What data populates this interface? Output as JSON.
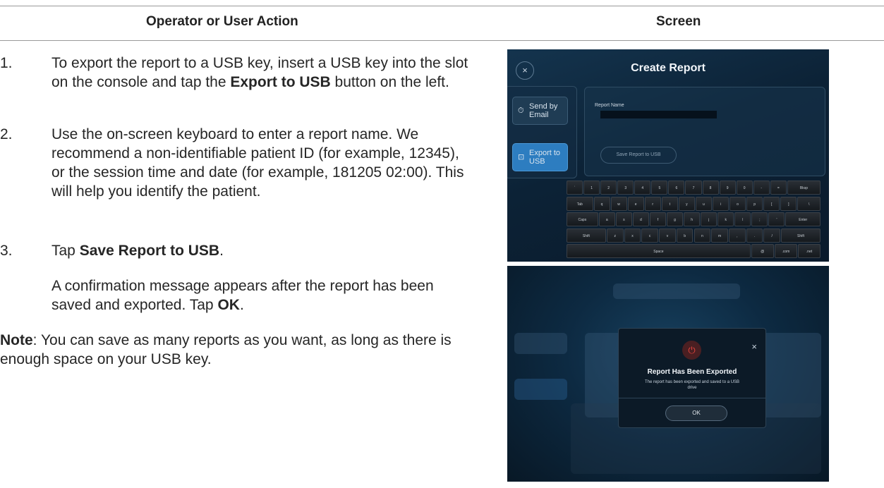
{
  "header": {
    "col_action": "Operator or User Action",
    "col_screen": "Screen"
  },
  "steps": [
    {
      "num": "1.",
      "parts": [
        "To export the report to a USB key, insert a USB key into the slot on the console and tap the ",
        "Export to USB",
        " button on the left."
      ]
    },
    {
      "num": "2.",
      "parts": [
        "Use the on-screen keyboard to enter a report name. We recommend a non-identifiable patient ID (for example, 12345), or the session time and date (for example, 181205 02:00). This will help you identify the patient."
      ]
    },
    {
      "num": "3.",
      "parts": [
        "Tap ",
        "Save Report to USB",
        "."
      ]
    }
  ],
  "confirm": {
    "parts": [
      "A confirmation message appears after the report has been saved and exported. Tap ",
      "OK",
      "."
    ]
  },
  "note": {
    "label": "Note",
    "text": ": You can save as many reports as you want, as long as there is enough space on your USB key."
  },
  "screen1": {
    "close_icon": "×",
    "title": "Create Report",
    "send_email_label": "Send by Email",
    "send_email_icon": "⏱",
    "export_usb_label": "Export to USB",
    "export_usb_icon": "⊡",
    "report_name_label": "Report Name",
    "save_button": "Save Report to USB",
    "keyboard": [
      [
        "`",
        "1",
        "2",
        "3",
        "4",
        "5",
        "6",
        "7",
        "8",
        "9",
        "0",
        "-",
        "=",
        "Bksp"
      ],
      [
        "Tab",
        "q",
        "w",
        "e",
        "r",
        "t",
        "y",
        "u",
        "i",
        "o",
        "p",
        "[",
        "]",
        "\\"
      ],
      [
        "Caps",
        "a",
        "s",
        "d",
        "f",
        "g",
        "h",
        "j",
        "k",
        "l",
        ";",
        "'",
        "Enter"
      ],
      [
        "Shift",
        "z",
        "x",
        "c",
        "v",
        "b",
        "n",
        "m",
        ",",
        ".",
        "/",
        "Shift"
      ],
      [
        "Space",
        "@",
        ".com",
        ".net"
      ]
    ]
  },
  "screen2": {
    "dialog_title": "Report Has Been Exported",
    "dialog_message": "The report has been exported and saved to a USB drive",
    "ok_button": "OK",
    "close_icon": "×",
    "power_icon": "⏻"
  }
}
